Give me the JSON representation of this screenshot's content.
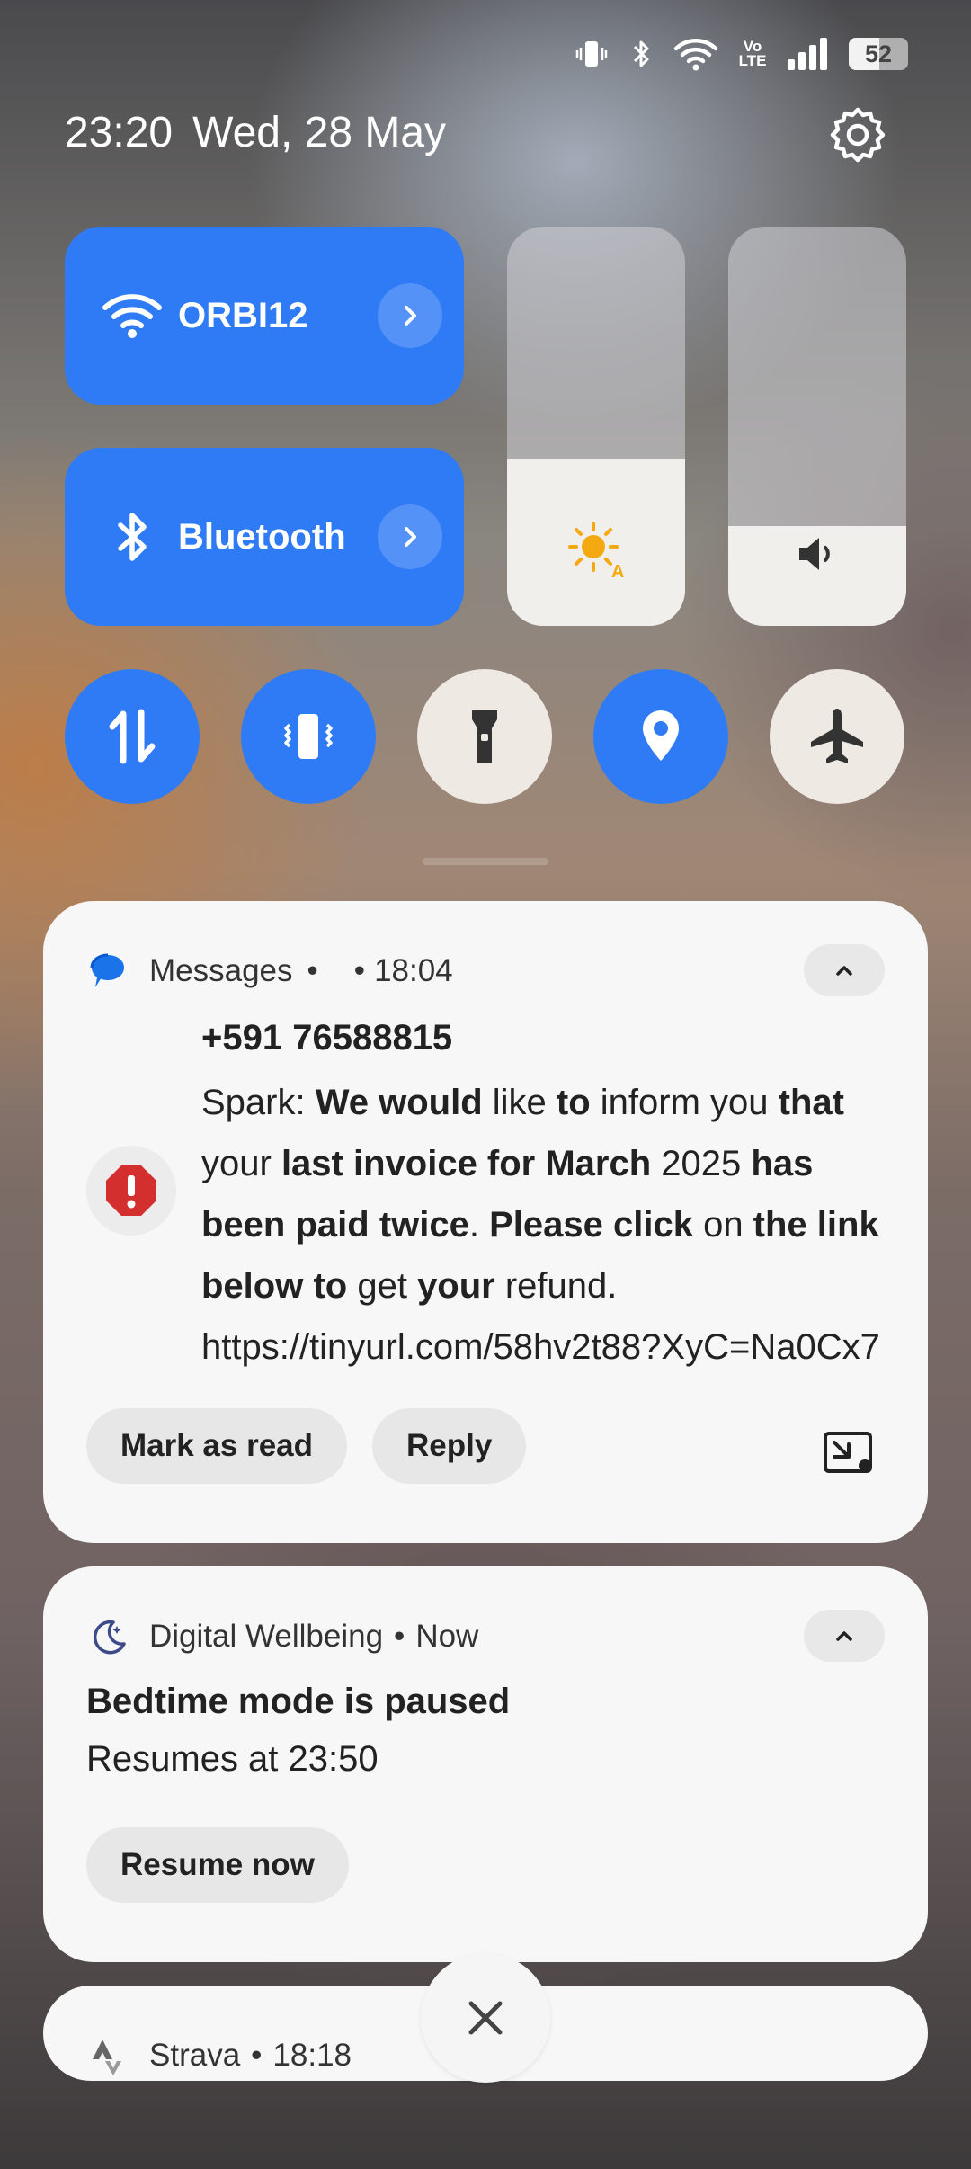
{
  "status_bar": {
    "icons": [
      "vibrate-icon",
      "bluetooth-icon",
      "wifi-icon",
      "volte-icon",
      "signal-icon"
    ],
    "volte_text": "Vo LTE",
    "battery_level": 52,
    "battery_text": "52"
  },
  "header": {
    "time": "23:20",
    "date": "Wed, 28 May"
  },
  "quick_settings": {
    "wifi": {
      "label": "ORBI12",
      "active": true
    },
    "bluetooth": {
      "label": "Bluetooth",
      "active": true
    },
    "brightness": {
      "level": 0.42,
      "icon": "auto-brightness-icon",
      "auto_mark": "A"
    },
    "volume": {
      "level": 0.25,
      "icon": "volume-icon"
    },
    "toggles": [
      {
        "name": "mobile-data",
        "active": true
      },
      {
        "name": "vibrate",
        "active": true
      },
      {
        "name": "flashlight",
        "active": false
      },
      {
        "name": "location",
        "active": true
      },
      {
        "name": "airplane-mode",
        "active": false
      }
    ],
    "accent_color": "#2f7bf6"
  },
  "notifications": {
    "messages": {
      "app": "Messages",
      "sep1": "•",
      "sep2": "•",
      "time": "18:04",
      "sender": "+591 76588815",
      "body_segments": [
        {
          "t": " Spark: ",
          "b": false
        },
        {
          "t": "We would",
          "b": true
        },
        {
          "t": " like ",
          "b": false
        },
        {
          "t": "to",
          "b": true
        },
        {
          "t": " inform you ",
          "b": false
        },
        {
          "t": "that",
          "b": true
        },
        {
          "t": " your ",
          "b": false
        },
        {
          "t": "last invoice for March",
          "b": true
        },
        {
          "t": " 2025 ",
          "b": false
        },
        {
          "t": "has been paid twice",
          "b": true
        },
        {
          "t": ". ",
          "b": false
        },
        {
          "t": "Please click",
          "b": true
        },
        {
          "t": " on ",
          "b": false
        },
        {
          "t": "the link below to",
          "b": true
        },
        {
          "t": " get ",
          "b": false
        },
        {
          "t": "your",
          "b": true
        },
        {
          "t": " refund. https://tinyurl.com/58hv2t88?XyC=Na0Cx7",
          "b": false
        }
      ],
      "actions": {
        "mark_read": "Mark as read",
        "reply": "Reply"
      },
      "avatar_icon": "warning-icon",
      "warning_color": "#d32f2f"
    },
    "wellbeing": {
      "app": "Digital Wellbeing",
      "sep": "•",
      "time": "Now",
      "title": "Bedtime mode is paused",
      "subtitle": "Resumes at 23:50",
      "action": "Resume now"
    },
    "strava": {
      "app": "Strava",
      "sep": "•",
      "time": "18:18"
    }
  }
}
